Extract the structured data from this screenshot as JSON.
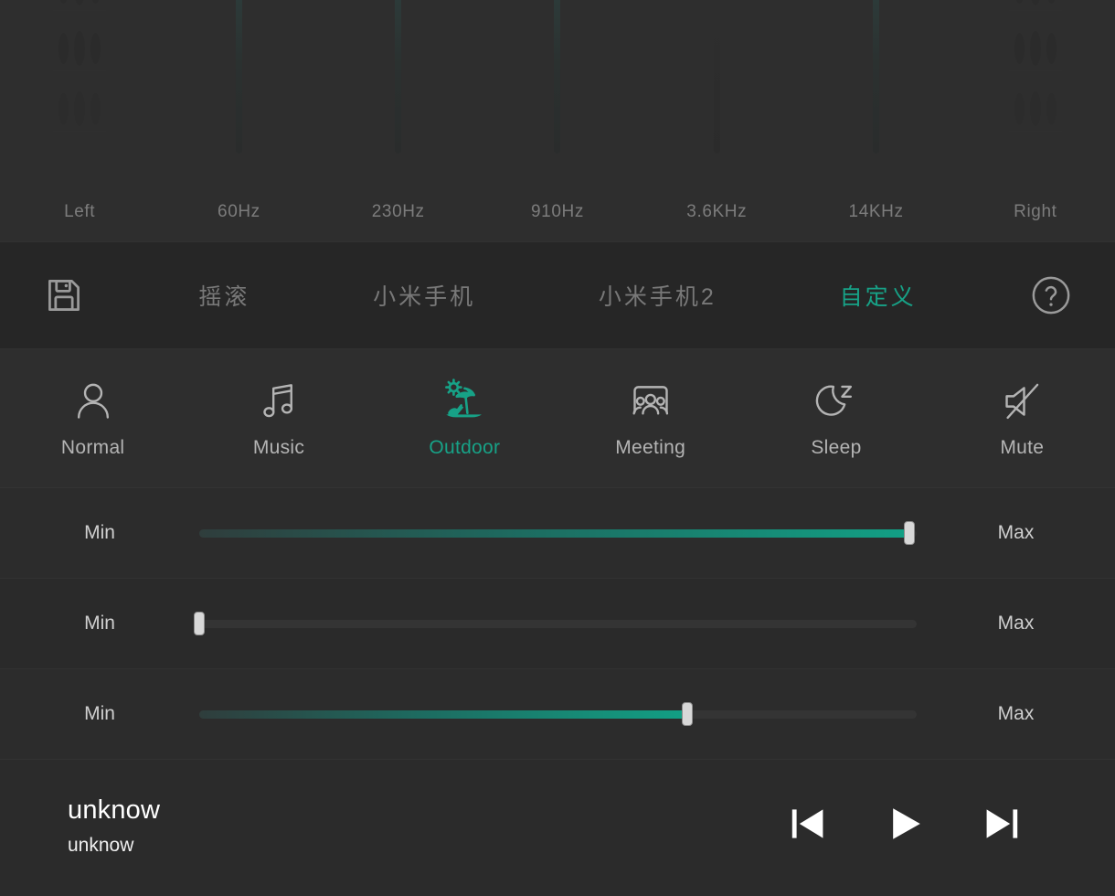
{
  "equalizer": {
    "bands": [
      {
        "label": "Left",
        "active": false
      },
      {
        "label": "60Hz",
        "active": true
      },
      {
        "label": "230Hz",
        "active": true
      },
      {
        "label": "910Hz",
        "active": true
      },
      {
        "label": "3.6KHz",
        "active": true
      },
      {
        "label": "14KHz",
        "active": true
      },
      {
        "label": "Right",
        "active": false
      }
    ]
  },
  "presets": {
    "save_icon": "floppy-disk-save-icon",
    "help_icon": "question-mark-help-icon",
    "items": [
      {
        "label": "摇滚",
        "active": false
      },
      {
        "label": "小米手机",
        "active": false
      },
      {
        "label": "小米手机2",
        "active": false
      },
      {
        "label": "自定义",
        "active": true
      }
    ]
  },
  "sound_modes": [
    {
      "label": "Normal",
      "icon": "person-icon",
      "active": false
    },
    {
      "label": "Music",
      "icon": "music-note-icon",
      "active": false
    },
    {
      "label": "Outdoor",
      "icon": "beach-umbrella-icon",
      "active": true
    },
    {
      "label": "Meeting",
      "icon": "meeting-group-icon",
      "active": false
    },
    {
      "label": "Sleep",
      "icon": "moon-z-sleep-icon",
      "active": false
    },
    {
      "label": "Mute",
      "icon": "speaker-muted-icon",
      "active": false
    }
  ],
  "volume_sliders": [
    {
      "min_label": "Min",
      "max_label": "Max",
      "value": 99
    },
    {
      "min_label": "Min",
      "max_label": "Max",
      "value": 0
    },
    {
      "min_label": "Min",
      "max_label": "Max",
      "value": 68
    }
  ],
  "player": {
    "title": "unknow",
    "artist": "unknow",
    "prev_icon": "skip-previous-icon",
    "play_icon": "play-icon",
    "next_icon": "skip-next-icon"
  },
  "colors": {
    "accent": "#17a287",
    "background": "#2b2b2b",
    "panel": "#2e2e2e",
    "preset_bar": "#262626",
    "text": "#c8c8c8",
    "muted_text": "#7c7c7c"
  }
}
